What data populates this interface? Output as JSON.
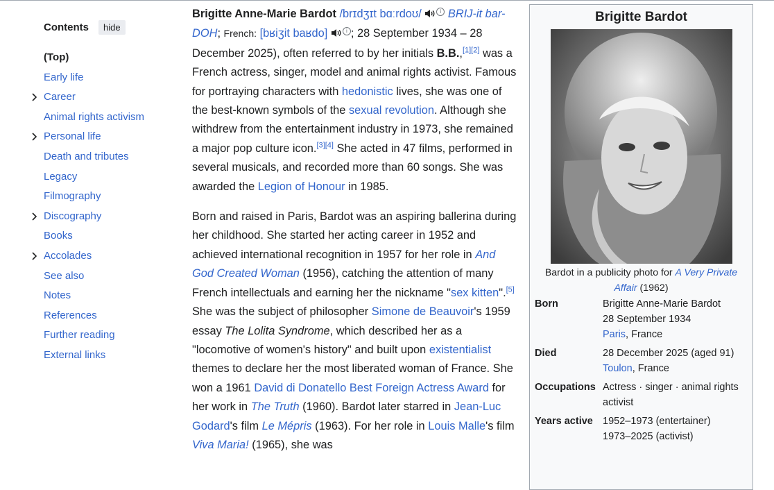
{
  "toc": {
    "title": "Contents",
    "hide_label": "hide",
    "items": [
      {
        "label": "(Top)",
        "expandable": false
      },
      {
        "label": "Early life",
        "expandable": false
      },
      {
        "label": "Career",
        "expandable": true
      },
      {
        "label": "Animal rights activism",
        "expandable": false
      },
      {
        "label": "Personal life",
        "expandable": true
      },
      {
        "label": "Death and tributes",
        "expandable": false
      },
      {
        "label": "Legacy",
        "expandable": false
      },
      {
        "label": "Filmography",
        "expandable": false
      },
      {
        "label": "Discography",
        "expandable": true
      },
      {
        "label": "Books",
        "expandable": false
      },
      {
        "label": "Accolades",
        "expandable": true
      },
      {
        "label": "See also",
        "expandable": false
      },
      {
        "label": "Notes",
        "expandable": false
      },
      {
        "label": "References",
        "expandable": false
      },
      {
        "label": "Further reading",
        "expandable": false
      },
      {
        "label": "External links",
        "expandable": false
      }
    ]
  },
  "article": {
    "p1": {
      "name_bold": "Brigitte Anne-Marie Bardot",
      "ipa1": "/brɪdʒɪt bɑːrdoʊ/",
      "respell": "BRIJ-it bar-DOH",
      "french_label": "French:",
      "ipa2": "[bʁiʒit baʁdo]",
      "after_ipa2": "; 28 September 1934 – 28 December 2025), often referred to by her initials",
      "initials_bold": "B.B.",
      "ref12": "[1][2]",
      "t1": "was a French actress, singer, model and animal rights activist. Famous for portraying characters with",
      "l_hedonistic": "hedonistic",
      "t2": "lives, she was one of the best-known symbols of the",
      "l_sexual": "sexual revolution",
      "t3": ". Although she withdrew from the entertainment industry in 1973, she remained a major pop culture icon.",
      "ref34": "[3][4]",
      "t4": "She acted in 47 films, performed in several musicals, and recorded more than 60 songs. She was awarded the",
      "l_legion": "Legion of Honour",
      "t5": "in 1985."
    },
    "p2": {
      "t1": "Born and raised in Paris, Bardot was an aspiring ballerina during her childhood. She started her acting career in 1952 and achieved international recognition in 1957 for her role in",
      "l_andgod": "And God Created Woman",
      "t2": "(1956), catching the attention of many French intellectuals and earning her the nickname \"",
      "l_sexkitten": "sex kitten",
      "t3": "\".",
      "ref5": "[5]",
      "t4": "She was the subject of philosopher",
      "l_simone": "Simone de Beauvoir",
      "t5": "'s 1959 essay",
      "i_lolita": "The Lolita Syndrome",
      "t6": ", which described her as a \"locomotive of women's history\" and built upon",
      "l_exist": "existentialist",
      "t7": "themes to declare her the most liberated woman of France. She won a 1961",
      "l_david": "David di Donatello Best Foreign Actress Award",
      "t8": "for her work in",
      "l_truth": "The Truth",
      "t9": "(1960). Bardot later starred in",
      "l_godard": "Jean-Luc Godard",
      "t10": "'s film",
      "l_mepris": "Le Mépris",
      "t11": "(1963). For her role in",
      "l_malle": "Louis Malle",
      "t12": "'s film",
      "l_viva": "Viva Maria!",
      "t13": "(1965), she was"
    }
  },
  "infobox": {
    "title": "Brigitte Bardot",
    "caption_pre": "Bardot in a publicity photo for",
    "caption_link": "A Very Private Affair",
    "caption_post": "(1962)",
    "born_label": "Born",
    "born_name": "Brigitte Anne-Marie Bardot",
    "born_date": "28 September 1934",
    "born_city": "Paris",
    "born_country": ", France",
    "died_label": "Died",
    "died_date": "28 December 2025 (aged 91)",
    "died_city": "Toulon",
    "died_country": ", France",
    "occ_label": "Occupations",
    "occ_value": "Actress · singer · animal rights activist",
    "years_label": "Years active",
    "years_1": "1952–1973 (entertainer)",
    "years_2": "1973–2025 (activist)"
  }
}
